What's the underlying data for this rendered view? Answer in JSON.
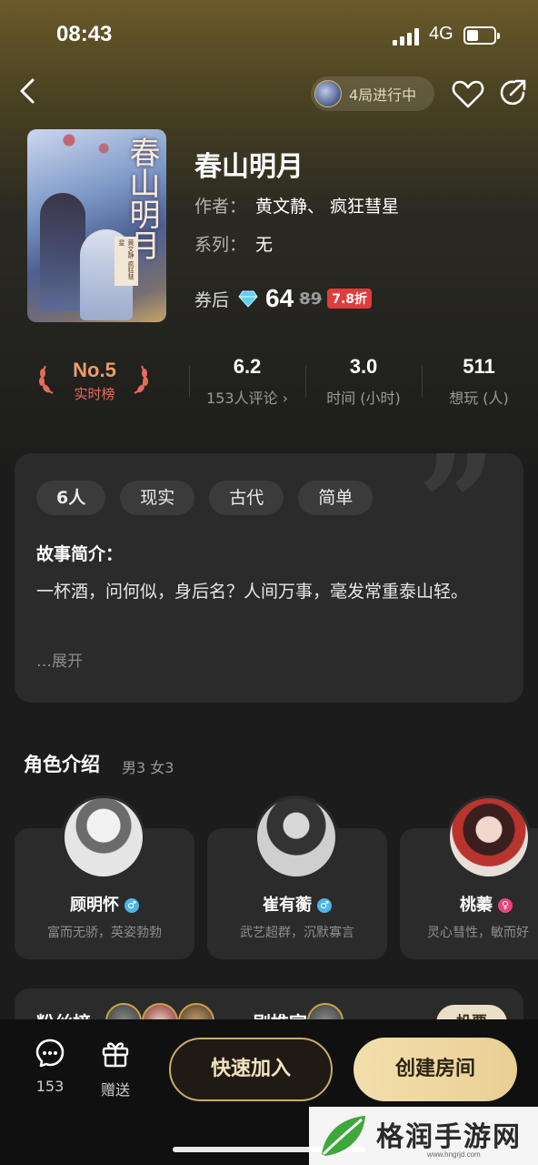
{
  "status_bar": {
    "time": "08:43",
    "network": "4G"
  },
  "header": {
    "in_game_text": "4局进行中"
  },
  "book": {
    "cover_title": "春山明月",
    "cover_subtitle": "黄文静 疯狂彗星",
    "title": "春山明月",
    "author_label": "作者：",
    "author_value": "黄文静、 疯狂彗星",
    "series_label": "系列：",
    "series_value": "无",
    "price_label": "券后",
    "price": "64",
    "original_price": "89",
    "discount": "7.8折"
  },
  "stats": {
    "rank_no": "No.5",
    "rank_label": "实时榜",
    "rating": "6.2",
    "reviews": "153人评论 ›",
    "duration": "3.0",
    "duration_label": "时间 (小时)",
    "want": "511",
    "want_label": "想玩 (人)"
  },
  "story": {
    "tags": [
      "6人",
      "现实",
      "古代",
      "简单"
    ],
    "heading": "故事简介：",
    "text": "一杯酒，问何似，身后名？人间万事，毫发常重泰山轻。",
    "expand": "…展开"
  },
  "roles": {
    "heading": "角色介绍",
    "count": "男3 女3",
    "items": [
      {
        "name": "顾明怀",
        "gender": "♂",
        "desc": "富而无骄，英姿勃勃"
      },
      {
        "name": "崔有蘅",
        "gender": "♂",
        "desc": "武艺超群，沉默寡言"
      },
      {
        "name": "桃蓁",
        "gender": "♀",
        "desc": "灵心彗性，敏而好"
      }
    ]
  },
  "fans": {
    "fan_rank": "粉丝榜",
    "recommend": "剧推官",
    "vote": "投票"
  },
  "bottom": {
    "comment_count": "153",
    "gift_label": "赠送",
    "quick_join": "快速加入",
    "create_room": "创建房间"
  },
  "watermark": {
    "text": "格润手游网",
    "url": "www.hngrjd.com"
  },
  "colors": {
    "accent_gold": "#e9cf94",
    "discount_red": "#e23b3b",
    "rank_orange": "#f09a6a"
  }
}
